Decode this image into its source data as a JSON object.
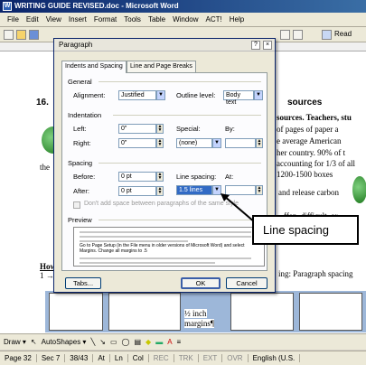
{
  "window": {
    "title": "WRITING GUIDE REVISED.doc - Microsoft Word"
  },
  "menu": [
    "File",
    "Edit",
    "View",
    "Insert",
    "Format",
    "Tools",
    "Table",
    "Window",
    "ACT!",
    "Help"
  ],
  "toolbar": {
    "read_label": "Read"
  },
  "document": {
    "lines": [
      {
        "text": "16.",
        "bold": true
      },
      {
        "text": "sources"
      },
      {
        "text": "sources. Teachers, stu"
      },
      {
        "text": "of pages of paper a"
      },
      {
        "text": "e average American"
      },
      {
        "text": "her country. 90% of t"
      },
      {
        "text": "accounting for 1/3 of all"
      },
      {
        "text": "1200-1500 boxes"
      },
      {
        "text": "the"
      },
      {
        "text": "and release carbon"
      },
      {
        "text": "ffen, difficult, or"
      },
      {
        "text": "How"
      },
      {
        "text": "1 →"
      },
      {
        "text": "ing: Paragraph spacing"
      },
      {
        "text": "½ inch"
      },
      {
        "text": "margins¶"
      }
    ]
  },
  "dialog": {
    "title": "Paragraph",
    "help_symbol": "?",
    "close_symbol": "×",
    "tabs": [
      "Indents and Spacing",
      "Line and Page Breaks"
    ],
    "general": {
      "heading": "General",
      "alignment_label": "Alignment:",
      "alignment_value": "Justified",
      "outline_label": "Outline level:",
      "outline_value": "Body text"
    },
    "indentation": {
      "heading": "Indentation",
      "left_label": "Left:",
      "left_value": "0\"",
      "right_label": "Right:",
      "right_value": "0\"",
      "special_label": "Special:",
      "special_value": "(none)",
      "by_label": "By:",
      "by_value": ""
    },
    "spacing": {
      "heading": "Spacing",
      "before_label": "Before:",
      "before_value": "0 pt",
      "after_label": "After:",
      "after_value": "0 pt",
      "line_spacing_label": "Line spacing:",
      "line_spacing_value": "1.5 lines",
      "at_label": "At:",
      "at_value": "",
      "dont_add_label": "Don't add space between paragraphs of the same style"
    },
    "preview": {
      "heading": "Preview",
      "sample_text": "Go to Page Setup (in the File menu in older versions of Microsoft Word) and select Margins. Change all margins to .5"
    },
    "buttons": {
      "tabs": "Tabs...",
      "ok": "OK",
      "cancel": "Cancel"
    }
  },
  "callout": {
    "text": "Line spacing"
  },
  "drawbar": {
    "draw": "Draw ▾",
    "autoshapes": "AutoShapes ▾"
  },
  "status": {
    "page": "Page 32",
    "sec": "Sec 7",
    "pages": "38/43",
    "at": "At",
    "ln": "Ln",
    "col": "Col",
    "rec": "REC",
    "trk": "TRK",
    "ext": "EXT",
    "ovr": "OVR",
    "lang": "English (U.S."
  },
  "colors": {
    "titlebar": "#0a246a",
    "accent": "#316ac5"
  }
}
